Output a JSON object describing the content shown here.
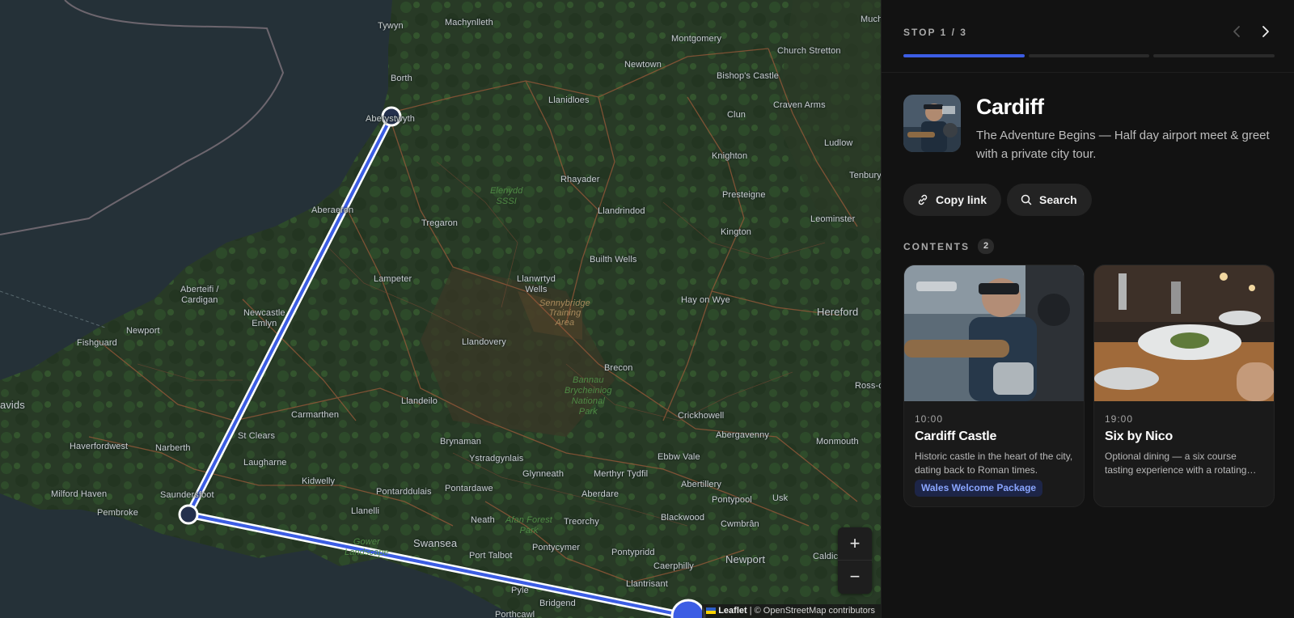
{
  "map": {
    "places": [
      {
        "name": "Machynlleth",
        "big": false
      },
      {
        "name": "Tywyn",
        "big": false
      },
      {
        "name": "Borth",
        "big": false
      },
      {
        "name": "Aberystwyth",
        "big": false
      },
      {
        "name": "Llanidloes",
        "big": false
      },
      {
        "name": "Newtown",
        "big": false
      },
      {
        "name": "Montgomery",
        "big": false
      },
      {
        "name": "Church Stretton",
        "big": false
      },
      {
        "name": "Bishop's Castle",
        "big": false
      },
      {
        "name": "Clun",
        "big": false
      },
      {
        "name": "Craven Arms",
        "big": false
      },
      {
        "name": "Ludlow",
        "big": false
      },
      {
        "name": "Tenbury",
        "big": false
      },
      {
        "name": "Knighton",
        "big": false
      },
      {
        "name": "Presteigne",
        "big": false
      },
      {
        "name": "Leominster",
        "big": false
      },
      {
        "name": "Kington",
        "big": false
      },
      {
        "name": "Rhayader",
        "big": false
      },
      {
        "name": "Llandrindod",
        "big": false
      },
      {
        "name": "Aberaeron",
        "big": false
      },
      {
        "name": "Tregaron",
        "big": false
      },
      {
        "name": "Builth Wells",
        "big": false
      },
      {
        "name": "Lampeter",
        "big": false
      },
      {
        "name": "Llanwrtyd\nWells",
        "big": false
      },
      {
        "name": "Aberteifi /\nCardigan",
        "big": false
      },
      {
        "name": "Newcastle\nEmlyn",
        "big": false
      },
      {
        "name": "Hay on Wye",
        "big": false
      },
      {
        "name": "Hereford",
        "big": true
      },
      {
        "name": "Fishguard",
        "big": false
      },
      {
        "name": "Newport",
        "big": false
      },
      {
        "name": "Llandovery",
        "big": false
      },
      {
        "name": "Brecon",
        "big": false
      },
      {
        "name": "avids",
        "big": true
      },
      {
        "name": "Llandeilo",
        "big": false
      },
      {
        "name": "Crickhowell",
        "big": false
      },
      {
        "name": "Ross-o",
        "big": false
      },
      {
        "name": "Carmarthen",
        "big": false
      },
      {
        "name": "Abergavenny",
        "big": false
      },
      {
        "name": "Monmouth",
        "big": false
      },
      {
        "name": "Haverfordwest",
        "big": false
      },
      {
        "name": "Narberth",
        "big": false
      },
      {
        "name": "St Clears",
        "big": false
      },
      {
        "name": "Brynaman",
        "big": false
      },
      {
        "name": "Ystradgynlais",
        "big": false
      },
      {
        "name": "Laugharne",
        "big": false
      },
      {
        "name": "Ebbw Vale",
        "big": false
      },
      {
        "name": "Glynneath",
        "big": false
      },
      {
        "name": "Merthyr Tydfil",
        "big": false
      },
      {
        "name": "Kidwelly",
        "big": false
      },
      {
        "name": "Abertillery",
        "big": false
      },
      {
        "name": "Milford Haven",
        "big": false
      },
      {
        "name": "Saundersfoot",
        "big": false
      },
      {
        "name": "Pontarddulais",
        "big": false
      },
      {
        "name": "Pontardawe",
        "big": false
      },
      {
        "name": "Aberdare",
        "big": false
      },
      {
        "name": "Pontypool",
        "big": false
      },
      {
        "name": "Usk",
        "big": false
      },
      {
        "name": "Pembroke",
        "big": false
      },
      {
        "name": "Llanelli",
        "big": false
      },
      {
        "name": "Neath",
        "big": false
      },
      {
        "name": "Treorchy",
        "big": false
      },
      {
        "name": "Blackwood",
        "big": false
      },
      {
        "name": "Cwmbrân",
        "big": false
      },
      {
        "name": "Swansea",
        "big": true
      },
      {
        "name": "Pontycymer",
        "big": false
      },
      {
        "name": "Pontypridd",
        "big": false
      },
      {
        "name": "Port Talbot",
        "big": false
      },
      {
        "name": "Caerphilly",
        "big": false
      },
      {
        "name": "Newport",
        "big": true
      },
      {
        "name": "Caldic",
        "big": false
      },
      {
        "name": "Llantrisant",
        "big": false
      },
      {
        "name": "Pyle",
        "big": false
      },
      {
        "name": "Bridgend",
        "big": false
      },
      {
        "name": "Porthcawl",
        "big": false
      },
      {
        "name": "Much",
        "big": false
      }
    ],
    "areas": [
      {
        "name": "Elenydd\nSSSI",
        "style": "green"
      },
      {
        "name": "Sennybridge\nTraining\nArea",
        "style": "brown"
      },
      {
        "name": "Bannau\nBrycheiniog\nNational\nPark",
        "style": "green"
      },
      {
        "name": "Afan Forest\nPark",
        "style": "green"
      },
      {
        "name": "Gower\nLandscape",
        "style": "green"
      }
    ],
    "zoom_in": "+",
    "zoom_out": "−",
    "attribution_brand": "Leaflet",
    "attribution_text": "| © OpenStreetMap contributors",
    "route_color": "#3c5de4"
  },
  "panel": {
    "stop_label": "STOP 1 / 3",
    "progress": {
      "current": 1,
      "total": 3
    },
    "title": "Cardiff",
    "subtitle": "The Adventure Begins — Half day airport meet & greet with a private city tour.",
    "buttons": {
      "copy_link": "Copy link",
      "search": "Search"
    },
    "contents_label": "CONTENTS",
    "contents_count": "2",
    "cards": [
      {
        "time": "10:00",
        "name": "Cardiff Castle",
        "description": "Historic castle in the heart of the city, dating back to Roman times.",
        "tag": "Wales Welcome Package"
      },
      {
        "time": "19:00",
        "name": "Six by Nico",
        "description": "Optional dining — a six course tasting experience with a rotating…",
        "tag": ""
      }
    ],
    "accent": "#3c5de4"
  }
}
